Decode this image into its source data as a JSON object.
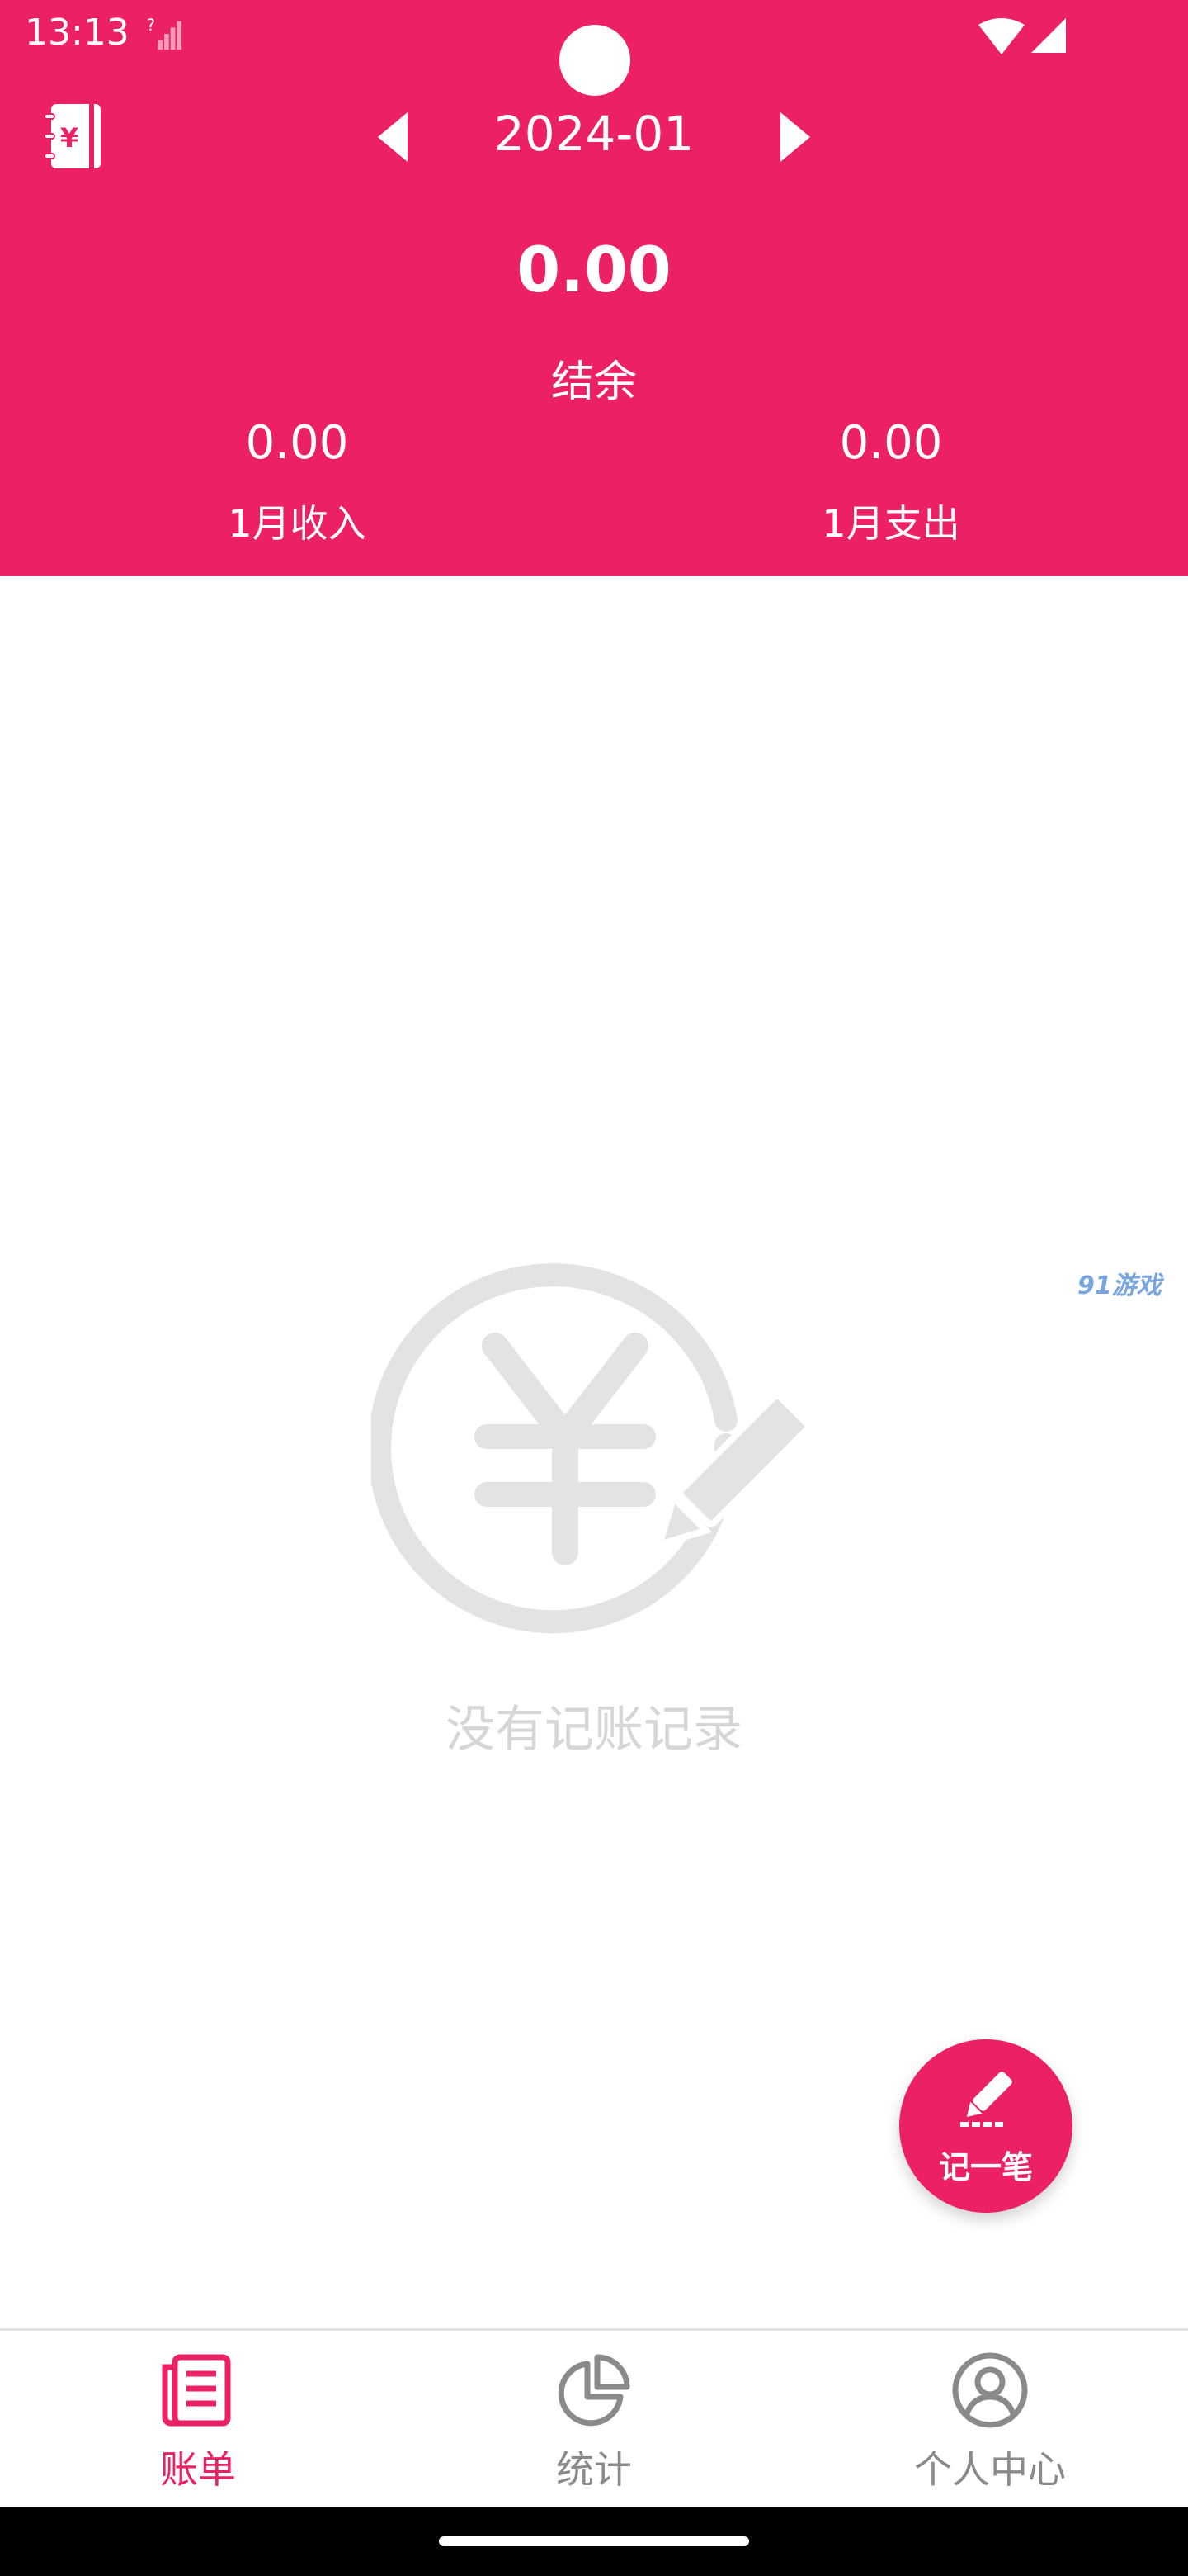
{
  "status_bar": {
    "time": "13:13"
  },
  "header": {
    "month": "2024-01",
    "balance_amount": "0.00",
    "balance_label": "结余",
    "income_value": "0.00",
    "income_label": "1月收入",
    "expense_value": "0.00",
    "expense_label": "1月支出"
  },
  "empty_state": {
    "text": "没有记账记录"
  },
  "watermark": {
    "text": "91游戏"
  },
  "fab": {
    "label": "记一笔"
  },
  "tabs": [
    {
      "label": "账单",
      "icon": "bill-icon",
      "active": true
    },
    {
      "label": "统计",
      "icon": "pie-chart-icon",
      "active": false
    },
    {
      "label": "个人中心",
      "icon": "user-icon",
      "active": false
    }
  ],
  "colors": {
    "accent": "#EC2064",
    "inactive": "#8a8a8a",
    "empty": "#e0e0e0"
  }
}
